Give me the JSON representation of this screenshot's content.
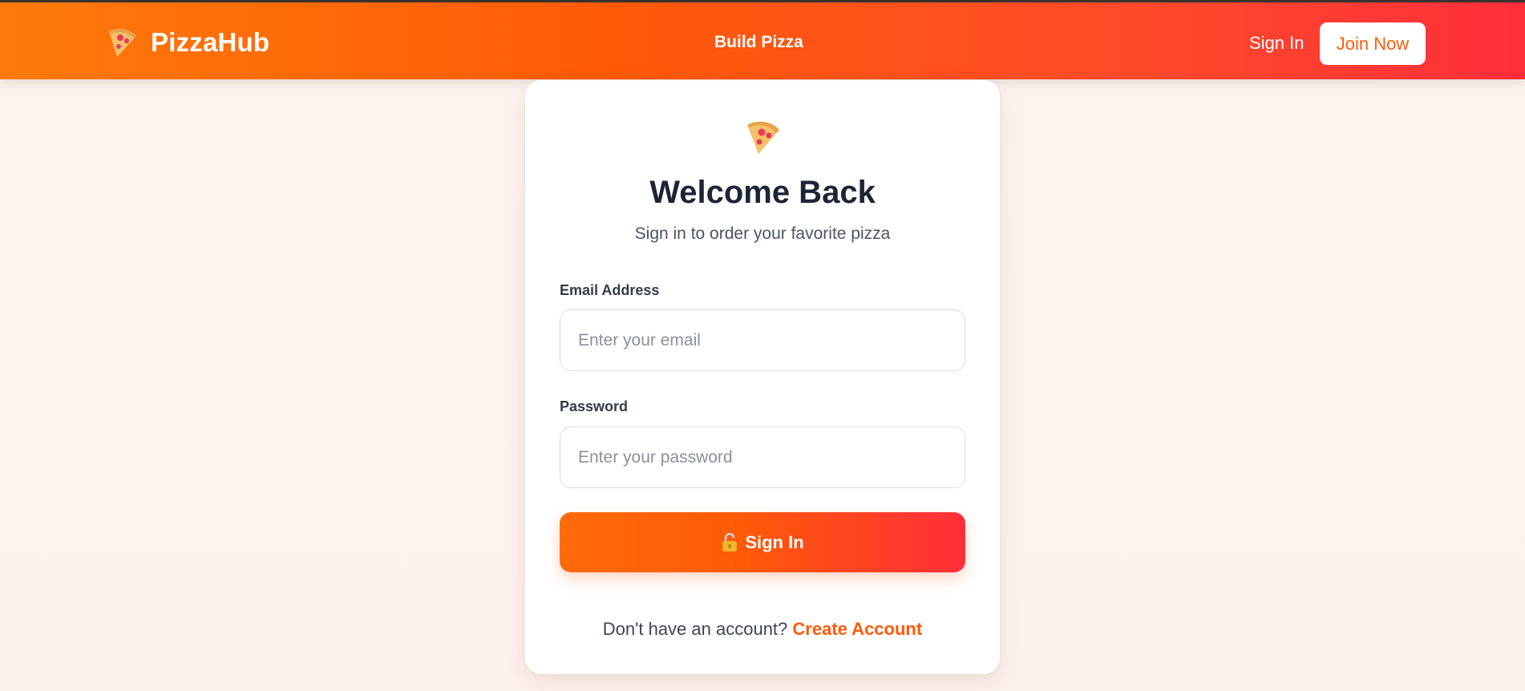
{
  "colors": {
    "brand_orange": "#ff5a08",
    "brand_red": "#ff2e3a",
    "heading": "#1c2436",
    "page_background": "#fdf3ee"
  },
  "navbar": {
    "logo_icon": "pizza-slice-icon",
    "brand_name": "PizzaHub",
    "center_link": "Build Pizza",
    "sign_in_label": "Sign In",
    "join_label": "Join Now"
  },
  "card": {
    "icon": "pizza-slice-icon",
    "title": "Welcome Back",
    "subtitle": "Sign in to order your favorite pizza",
    "email": {
      "label": "Email Address",
      "placeholder": "Enter your email",
      "value": ""
    },
    "password": {
      "label": "Password",
      "placeholder": "Enter your password",
      "value": ""
    },
    "submit": {
      "icon": "unlocked-padlock-icon",
      "label": "Sign In"
    },
    "footer": {
      "prompt": "Don't have an account?",
      "link": "Create Account"
    }
  }
}
